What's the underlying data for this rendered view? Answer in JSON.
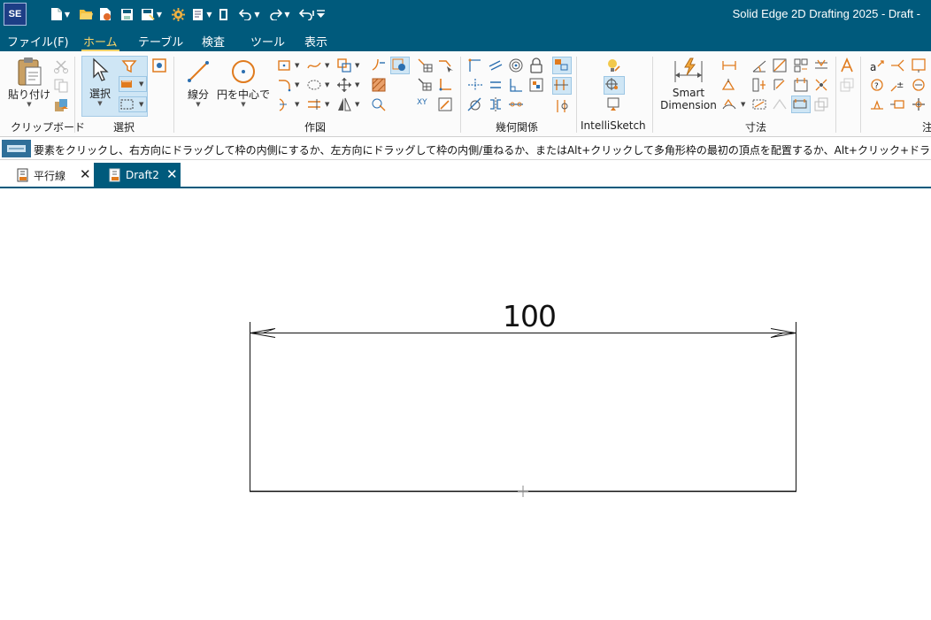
{
  "app": {
    "logo": "SE",
    "window_title": "Solid Edge 2D Drafting 2025 - Draft -"
  },
  "quick_access": [
    {
      "icon": "new-file-icon"
    },
    {
      "icon": "open-folder-icon"
    },
    {
      "icon": "open-recent-icon"
    },
    {
      "icon": "save-icon"
    },
    {
      "icon": "save-as-icon"
    },
    {
      "icon": "settings-icon"
    },
    {
      "icon": "print-icon"
    },
    {
      "icon": "close-document-icon"
    },
    {
      "icon": "undo-icon"
    },
    {
      "icon": "redo-icon"
    },
    {
      "icon": "repeat-icon"
    },
    {
      "icon": "customize-quick-access-icon"
    }
  ],
  "menu": {
    "tabs": [
      "ファイル(F)",
      "ホーム",
      "テーブル",
      "検査",
      "ツール",
      "表示"
    ],
    "active": "ホーム"
  },
  "ribbon": {
    "clipboard": {
      "group": "クリップボード",
      "paste": "貼り付け"
    },
    "select": {
      "group": "選択",
      "select": "選択"
    },
    "draw": {
      "group": "作図",
      "line": "線分",
      "circle": "円を中心で",
      "xy_label": "XY"
    },
    "relate": {
      "group": "幾何関係"
    },
    "intellisketch": {
      "group": "IntelliSketch"
    },
    "dimension": {
      "group": "寸法",
      "smart_dimension_1": "Smart",
      "smart_dimension_2": "Dimension"
    },
    "annotation": {
      "group_partial": "注"
    }
  },
  "prompt": {
    "text": "要素をクリックし、右方向にドラッグして枠の内側にするか、左方向にドラッグして枠の内側/重ねるか、またはAlt+クリックして多角形枠の最初の頂点を配置するか、Alt+クリック+ドラッグ"
  },
  "tabs": [
    {
      "label": "平行線",
      "active": false
    },
    {
      "label": "Draft2",
      "active": true
    }
  ],
  "drawing": {
    "dimension_value": "100"
  },
  "colors": {
    "titlebar": "#005a7c",
    "active_menu": "#f8d36a",
    "icon_orange": "#e07b1e",
    "icon_blue": "#2b6fb0"
  }
}
